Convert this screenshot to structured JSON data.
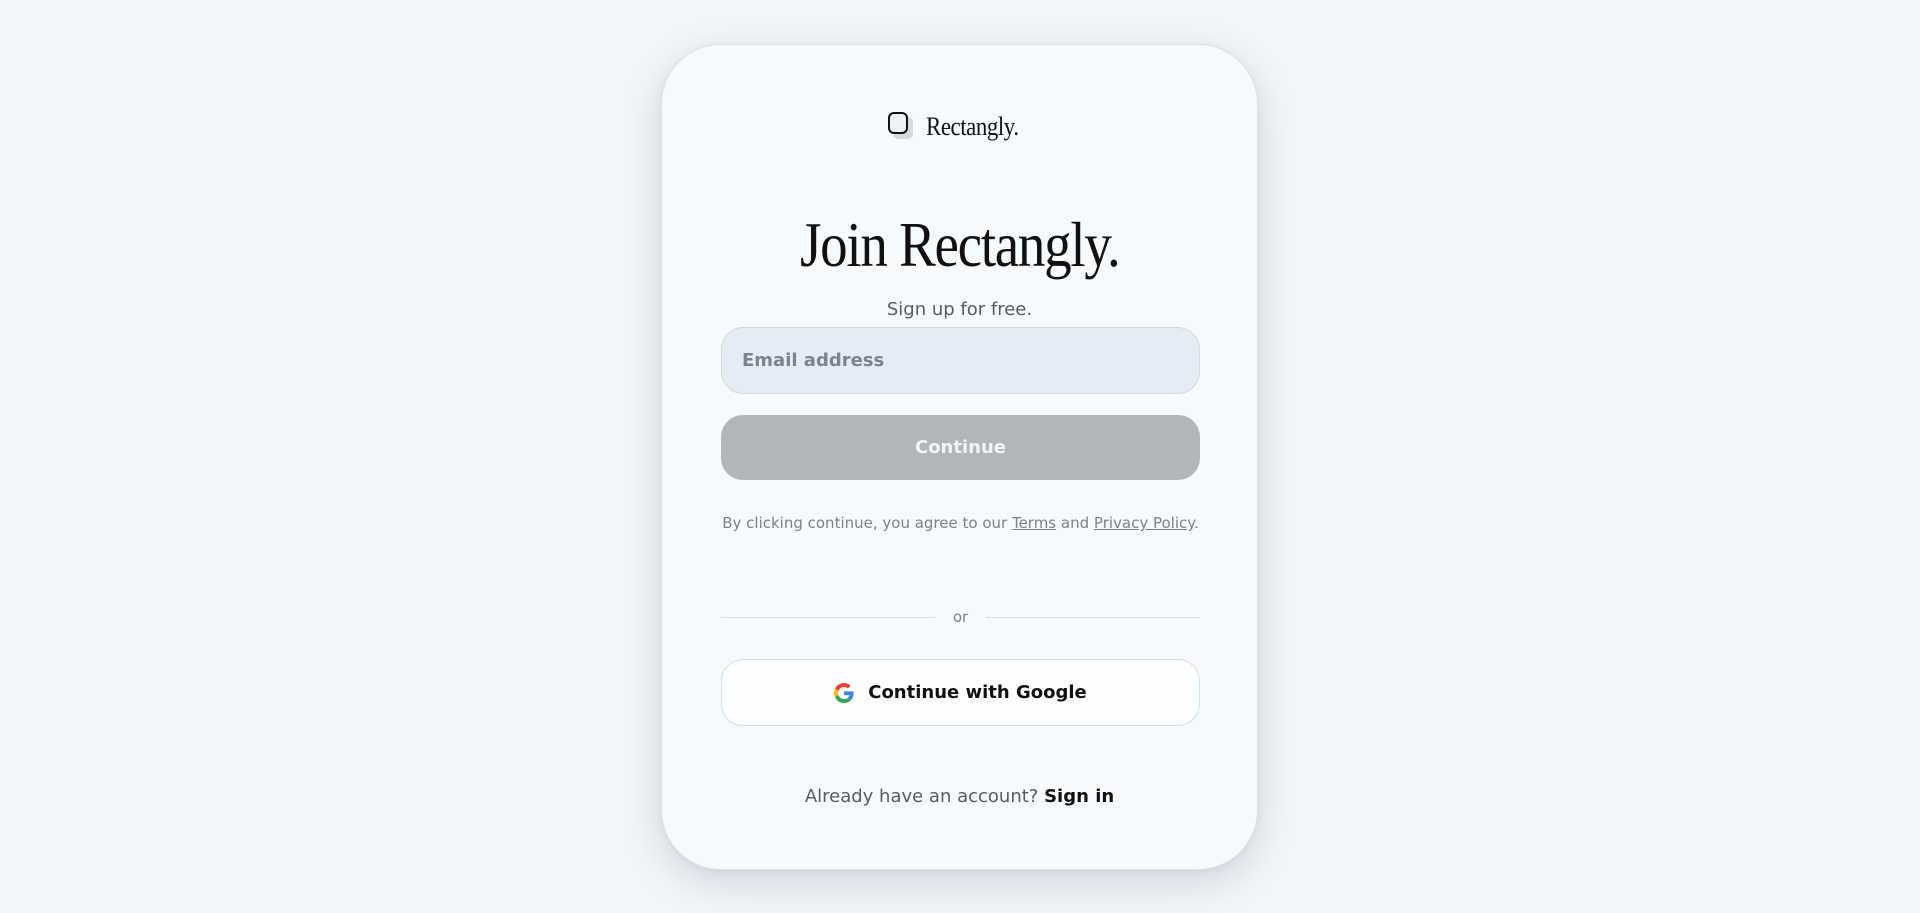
{
  "brand": {
    "name": "Rectangly.",
    "icon": "rectangle-logo-icon"
  },
  "header": {
    "title": "Join Rectangly.",
    "subtitle": "Sign up for free."
  },
  "form": {
    "email_placeholder": "Email address",
    "email_value": "",
    "continue_label": "Continue"
  },
  "terms": {
    "prefix": "By clicking continue, you agree to our ",
    "terms_link": "Terms",
    "middle": " and ",
    "privacy_link": "Privacy Policy",
    "suffix": "."
  },
  "divider": {
    "label": "or"
  },
  "google": {
    "label": "Continue with Google",
    "icon": "google-icon"
  },
  "footer": {
    "prompt": "Already have an account?",
    "signin_link": "Sign in"
  },
  "colors": {
    "background": "#f2f5f9",
    "card": "#f7fafc",
    "input_bg": "#e6ecf5",
    "button_disabled": "#b2b5b9",
    "text_primary": "#111111",
    "text_muted": "#555c66"
  }
}
